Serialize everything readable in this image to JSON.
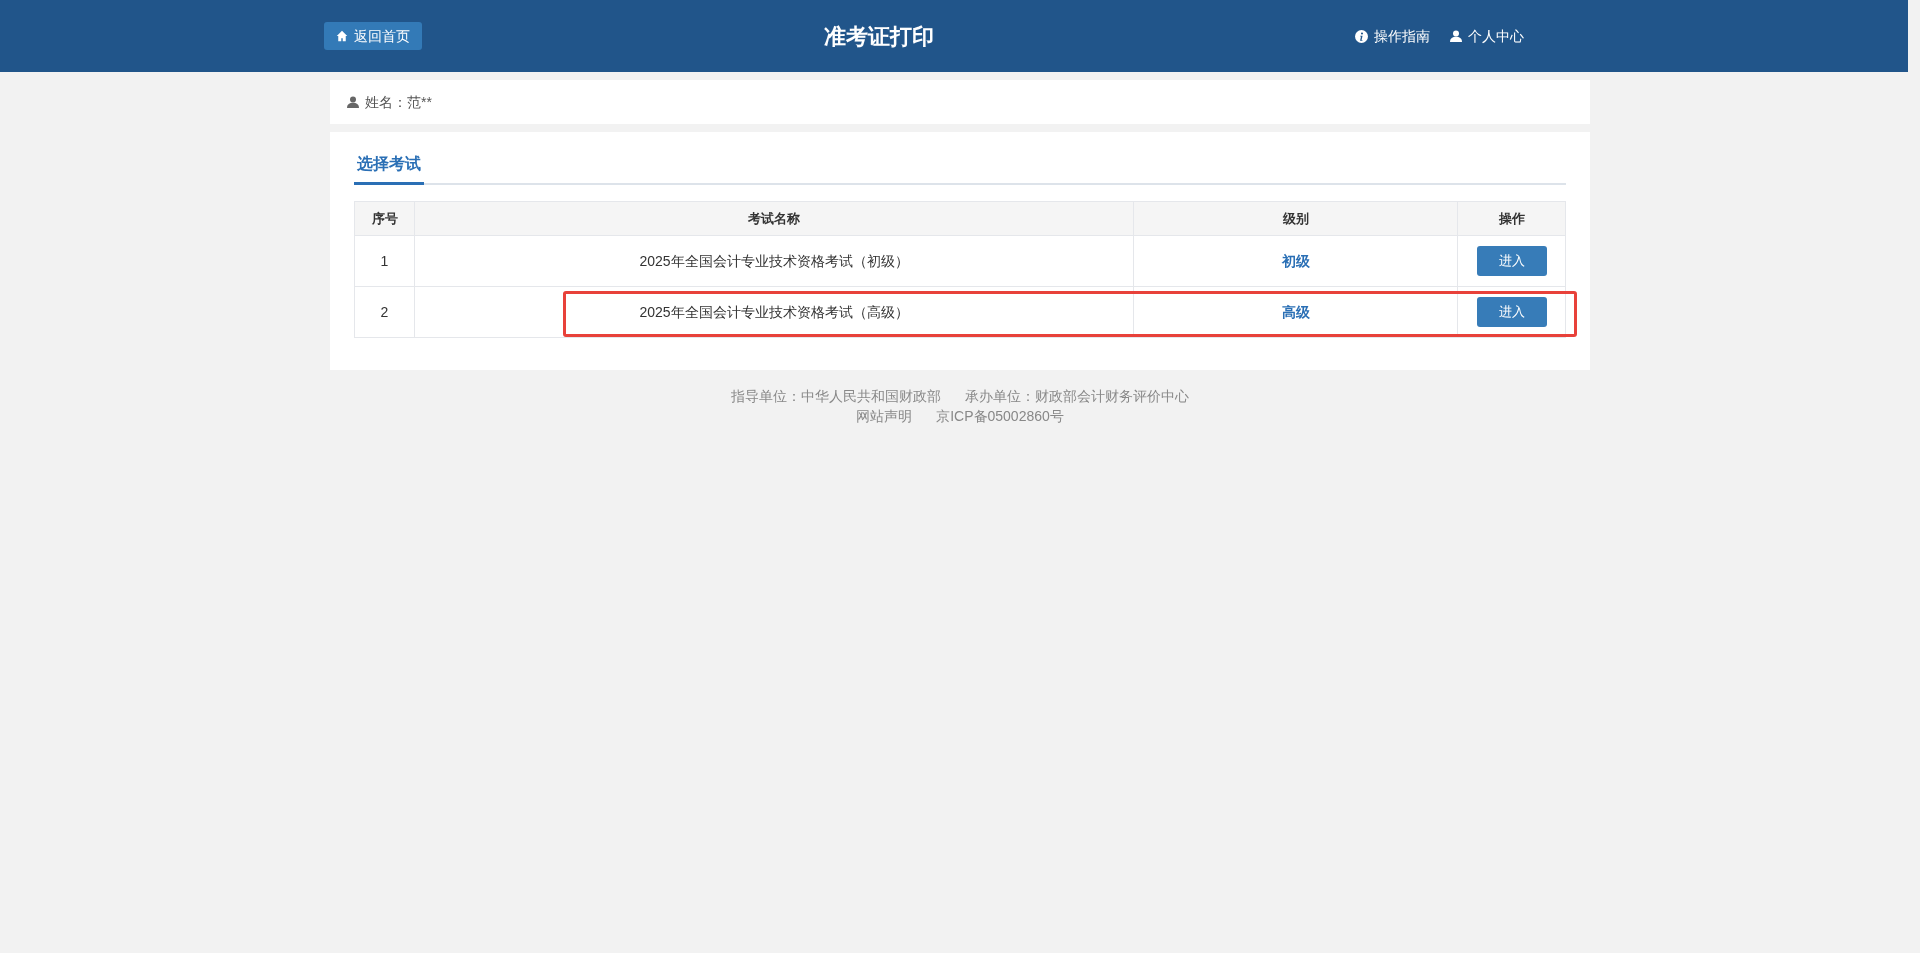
{
  "header": {
    "home_button": "返回首页",
    "title": "准考证打印",
    "links": [
      {
        "kind": "info",
        "label": "操作指南"
      },
      {
        "kind": "user",
        "label": "个人中心"
      }
    ]
  },
  "user_bar": {
    "label": "姓名：范**"
  },
  "tabs": [
    {
      "label": "选择考试",
      "selected": true
    }
  ],
  "table": {
    "columns": [
      "序号",
      "考试名称",
      "级别",
      "操作"
    ],
    "rows": [
      {
        "index": "1",
        "name": "2025年全国会计专业技术资格考试（初级）",
        "level_name": "初级",
        "action": "进入",
        "highlighted": false
      },
      {
        "index": "2",
        "name": "2025年全国会计专业技术资格考试（高级）",
        "level_name": "高级",
        "action": "进入",
        "highlighted": true
      }
    ]
  },
  "footer": {
    "line_1": [
      "指导单位：中华人民共和国财政部",
      "承办单位：财政部会计财务评价中心"
    ],
    "line_2": [
      "网站声明",
      "京ICP备05002860号"
    ]
  }
}
